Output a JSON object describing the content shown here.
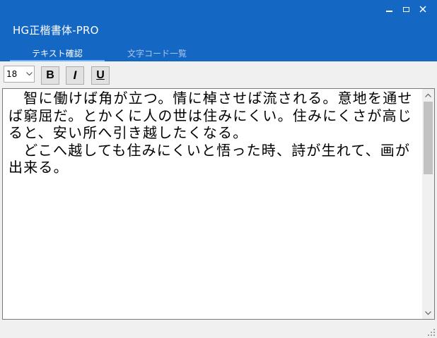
{
  "window": {
    "title": "HG正楷書体-PRO",
    "controls": {
      "minimize": "minimize",
      "maximize": "maximize",
      "close": "close"
    }
  },
  "tabs": [
    {
      "label": "テキスト確認",
      "active": true
    },
    {
      "label": "文字コード一覧",
      "active": false
    }
  ],
  "toolbar": {
    "font_size": "18",
    "bold_label": "B",
    "italic_label": "I",
    "underline_label": "U"
  },
  "editor": {
    "text": "　智に働けば角が立つ。情に棹させば流される。意地を通せば窮屈だ。とかくに人の世は住みにくい。住みにくさが高じると、安い所へ引き越したくなる。\n　どこへ越しても住みにくいと悟った時、詩が生れて、画が出来る。"
  },
  "colors": {
    "header_bg": "#1567c4",
    "tab_active_text": "#ffffff",
    "tab_inactive_text": "#a9c6ec",
    "tab_underline": "#6fb0ff"
  },
  "icons": [
    "minimize-icon",
    "maximize-icon",
    "close-icon",
    "chevron-down-icon",
    "scroll-up-arrow-icon",
    "scroll-down-arrow-icon",
    "resize-grip-icon"
  ]
}
